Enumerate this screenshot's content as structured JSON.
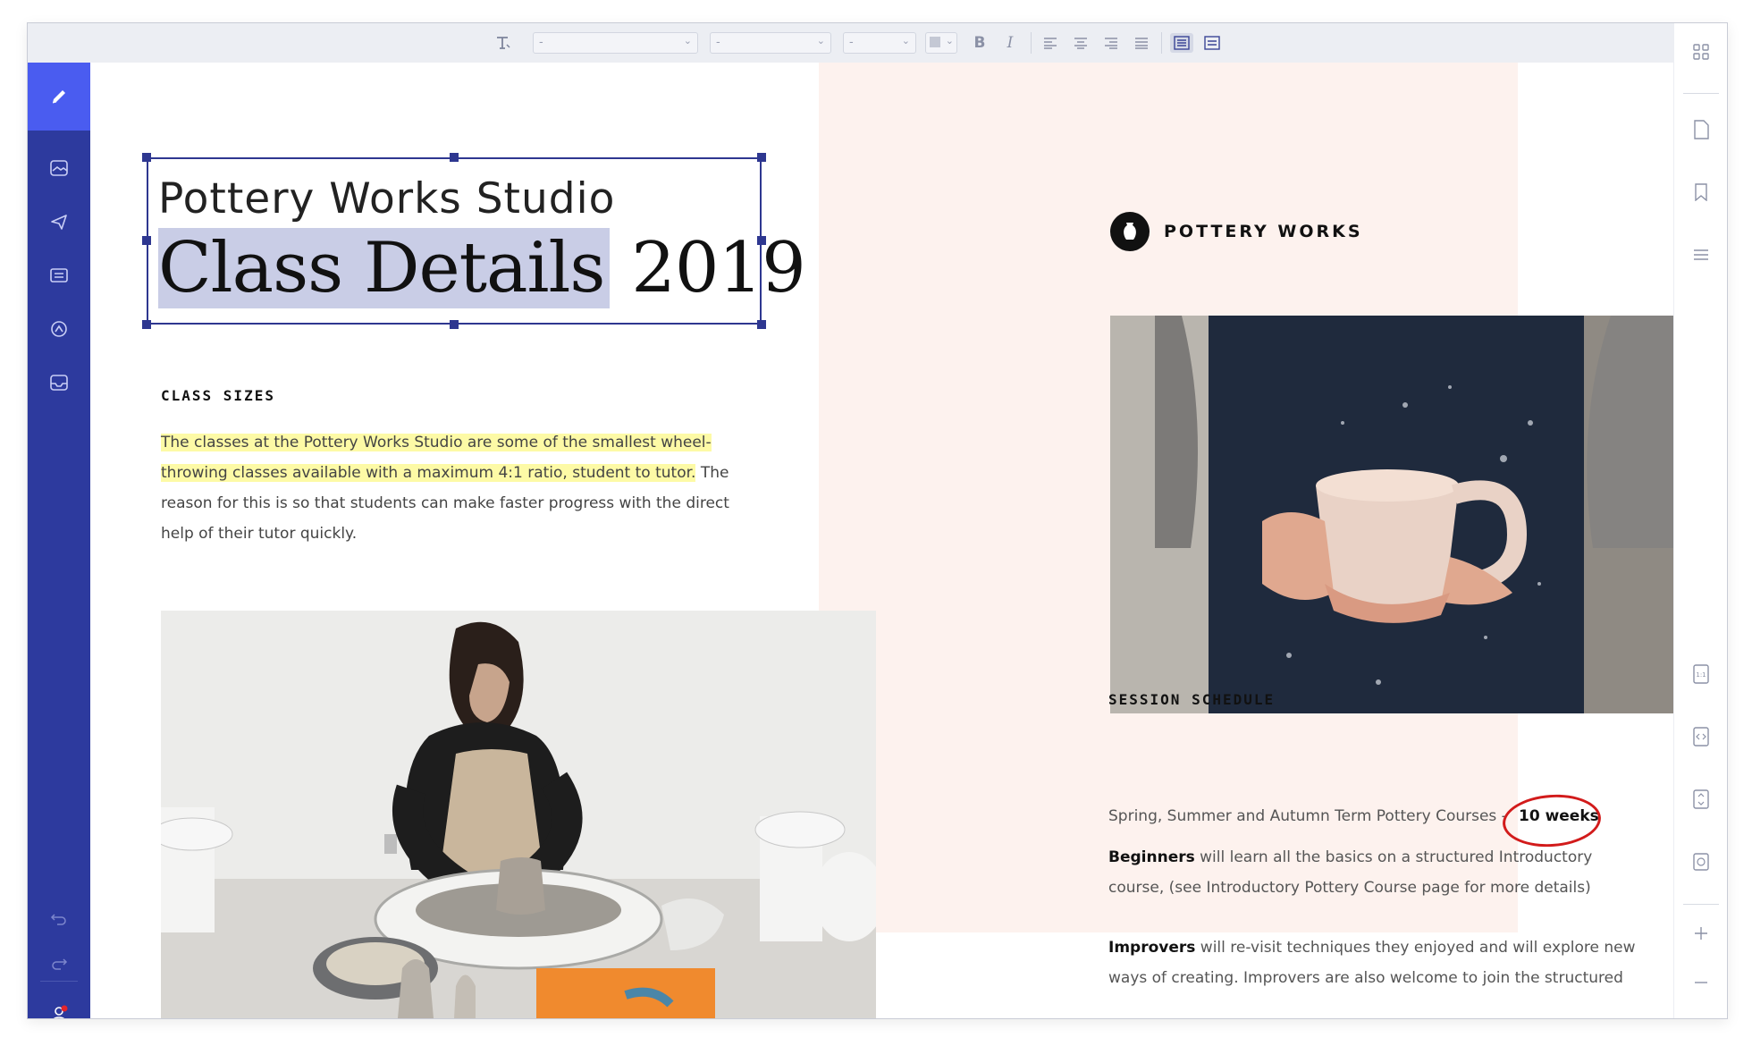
{
  "toolbar": {
    "font_family_value": "-",
    "font_weight_value": "-",
    "font_size_value": "-",
    "bold_label": "B",
    "italic_label": "I"
  },
  "document": {
    "subtitle": "Pottery Works Studio",
    "title_highlighted": "Class Details",
    "title_year": " 2019",
    "class_sizes": {
      "heading": "CLASS SIZES",
      "highlighted_text": "The classes at the Pottery Works Studio are some of the smallest wheel-throwing classes available with a maximum 4:1 ratio, student to tutor.",
      "rest_text": " The reason for this is so that students can make faster progress with the direct help of their tutor quickly."
    },
    "brand": {
      "name": "POTTERY WORKS"
    },
    "session_schedule": {
      "heading": "SESSION SCHEDULE",
      "line": "Spring, Summer and Autumn Term Pottery Courses -",
      "duration": "10 weeks",
      "beginners_label": "Beginners",
      "beginners_text": " will learn all the basics on a structured Introductory course, (see Introductory Pottery Course page for more details)",
      "improvers_label": "Improvers",
      "improvers_text": " will re-visit techniques they enjoyed and will explore new ways of creating. Improvers are also welcome to join the structured"
    }
  },
  "colors": {
    "sidebar": "#2d3a9e",
    "sidebar_active": "#4a5cf0",
    "selection": "#2e3790",
    "text_highlight": "#fdfaa6",
    "annotation_circle": "#d21b1b",
    "pink_panel": "#fdf2ee"
  },
  "icons": {
    "sidebar": [
      "pencil-icon",
      "image-icon",
      "send-icon",
      "layout-icon",
      "gauge-icon",
      "inbox-icon",
      "undo-icon",
      "redo-icon",
      "user-icon"
    ],
    "rightbar": [
      "grid-icon",
      "page-icon",
      "bookmark-icon",
      "list-icon",
      "actual-size-icon",
      "code-icon",
      "fit-page-icon",
      "fit-screen-icon",
      "zoom-in-icon",
      "zoom-out-icon"
    ]
  }
}
